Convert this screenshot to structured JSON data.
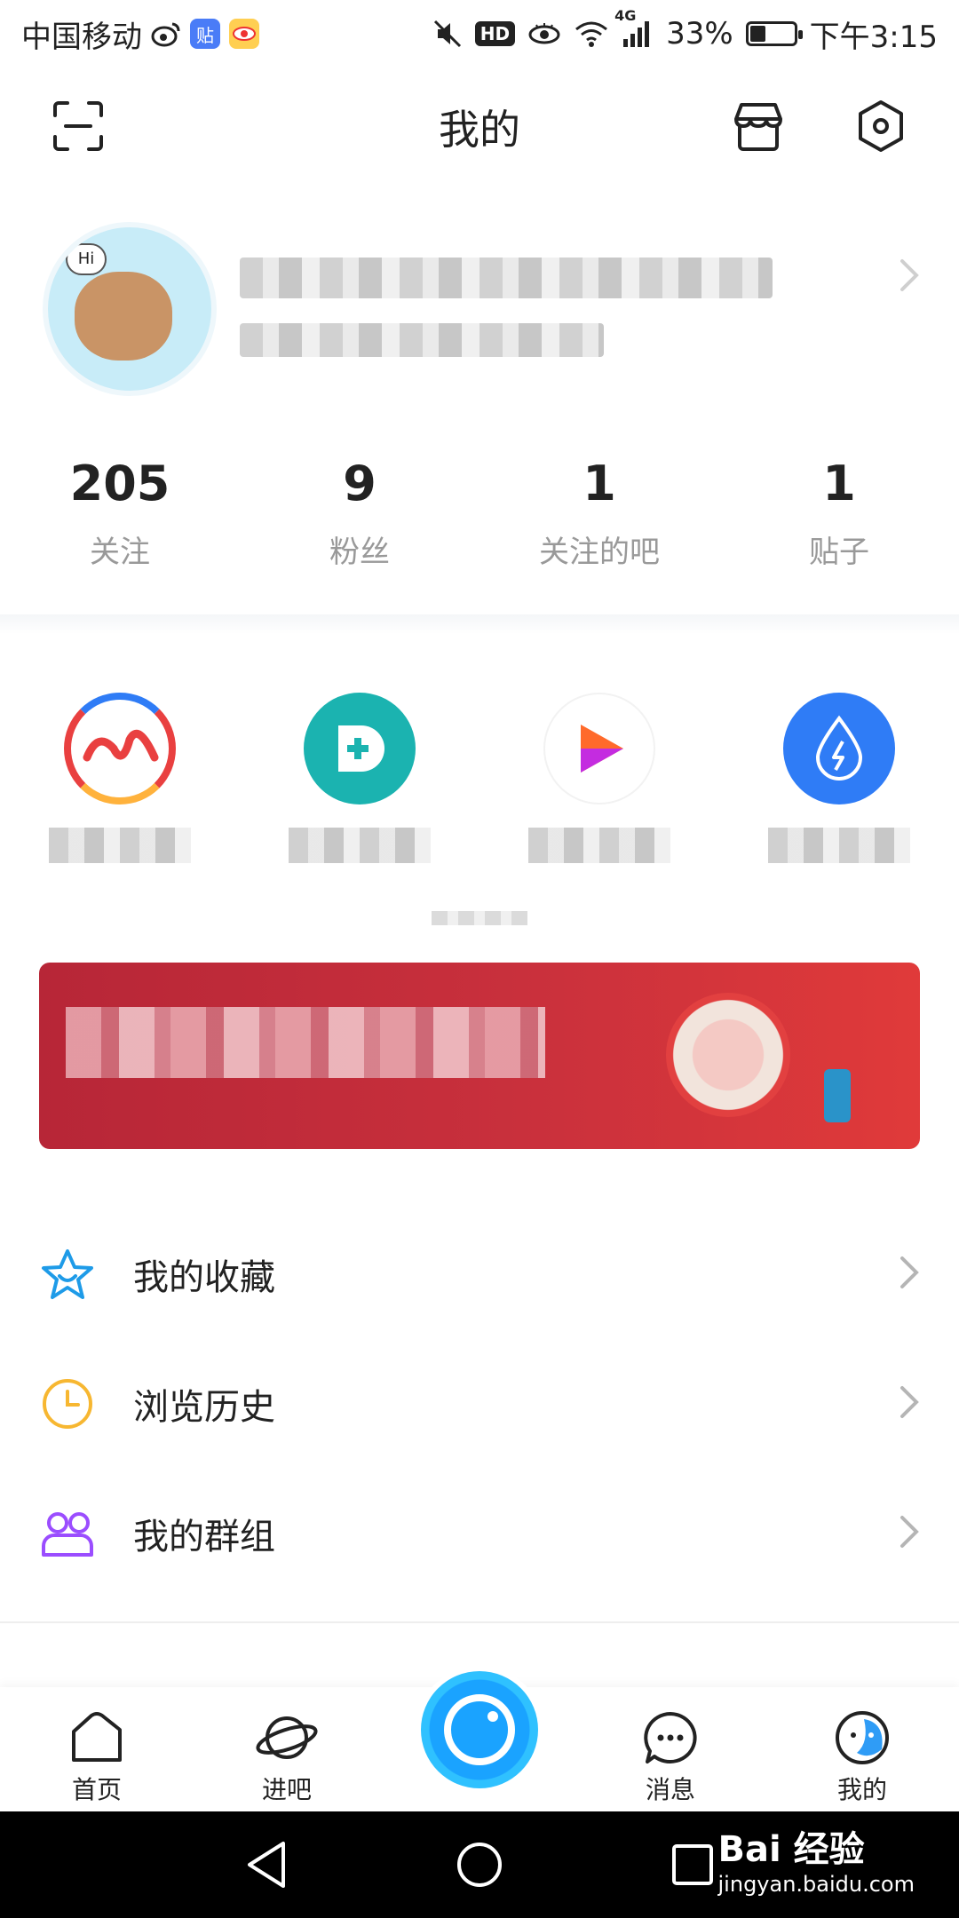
{
  "status_bar": {
    "carrier": "中国移动",
    "tieba_badge": "贴",
    "network": "4G",
    "hd": "HD",
    "battery_text": "33%",
    "battery_level": 0.33,
    "time": "下午3:15"
  },
  "header": {
    "title": "我的"
  },
  "stats": [
    {
      "value": "205",
      "label": "关注"
    },
    {
      "value": "9",
      "label": "粉丝"
    },
    {
      "value": "1",
      "label": "关注的吧"
    },
    {
      "value": "1",
      "label": "贴子"
    }
  ],
  "avatar": {
    "bubble_text": "Hi"
  },
  "menu": [
    {
      "label": "我的收藏",
      "icon": "star-icon",
      "color": "#1e9be8"
    },
    {
      "label": "浏览历史",
      "icon": "clock-icon",
      "color": "#f7b731"
    },
    {
      "label": "我的群组",
      "icon": "group-icon",
      "color": "#9b4dff"
    }
  ],
  "tabbar": {
    "items": [
      {
        "label": "首页"
      },
      {
        "label": "进吧"
      },
      {
        "label": "消息"
      },
      {
        "label": "我的"
      }
    ]
  },
  "watermark": {
    "brand": "Bai 经验",
    "url": "jingyan.baidu.com"
  },
  "colors": {
    "accent": "#1aa3ff",
    "banner_red": "#c9303c"
  }
}
